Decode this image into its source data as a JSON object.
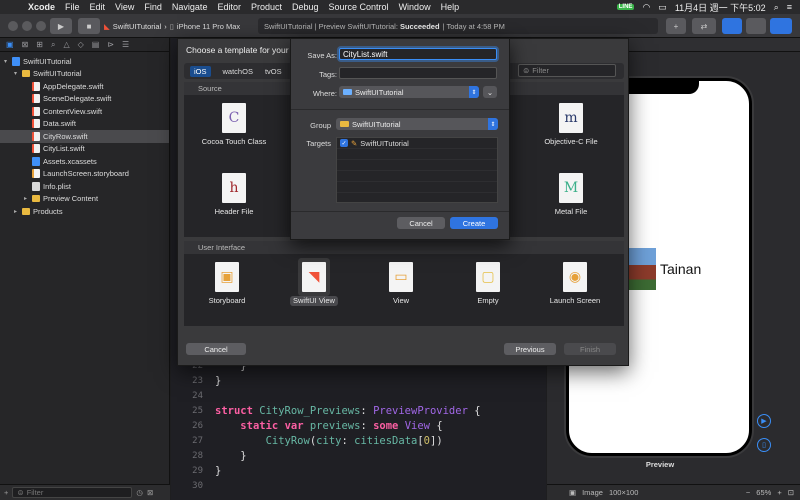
{
  "menubar": {
    "app": "Xcode",
    "items": [
      "File",
      "Edit",
      "View",
      "Find",
      "Navigate",
      "Editor",
      "Product",
      "Debug",
      "Source Control",
      "Window",
      "Help"
    ],
    "line_badge": "LINE",
    "clock": "11月4日 週一 下午5:02"
  },
  "toolbar": {
    "scheme": "SwiftUITutorial",
    "device": "iPhone 11 Pro Max",
    "activity_prefix": "SwiftUITutorial | Preview SwiftUITutorial:",
    "activity_status": "Succeeded",
    "activity_time": "| Today at 4:58 PM"
  },
  "navigator": {
    "items": [
      {
        "label": "SwiftUITutorial",
        "icon": "project",
        "indent": 0,
        "disclose": "▾"
      },
      {
        "label": "SwiftUITutorial",
        "icon": "folder",
        "indent": 1,
        "disclose": "▾"
      },
      {
        "label": "AppDelegate.swift",
        "icon": "swift",
        "indent": 2,
        "disclose": ""
      },
      {
        "label": "SceneDelegate.swift",
        "icon": "swift",
        "indent": 2,
        "disclose": ""
      },
      {
        "label": "ContentView.swift",
        "icon": "swift",
        "indent": 2,
        "disclose": ""
      },
      {
        "label": "Data.swift",
        "icon": "swift",
        "indent": 2,
        "disclose": ""
      },
      {
        "label": "CityRow.swift",
        "icon": "swift",
        "indent": 2,
        "disclose": "",
        "selected": true
      },
      {
        "label": "CityList.swift",
        "icon": "swift",
        "indent": 2,
        "disclose": ""
      },
      {
        "label": "Assets.xcassets",
        "icon": "blue",
        "indent": 2,
        "disclose": ""
      },
      {
        "label": "LaunchScreen.storyboard",
        "icon": "story",
        "indent": 2,
        "disclose": ""
      },
      {
        "label": "Info.plist",
        "icon": "plist",
        "indent": 2,
        "disclose": ""
      },
      {
        "label": "Preview Content",
        "icon": "folder",
        "indent": 2,
        "disclose": "▸"
      },
      {
        "label": "Products",
        "icon": "folder",
        "indent": 1,
        "disclose": "▸"
      }
    ],
    "filter_placeholder": "Filter"
  },
  "editor": {
    "lines": [
      {
        "n": "22",
        "code": "    }"
      },
      {
        "n": "23",
        "code": "}"
      },
      {
        "n": "24",
        "code": ""
      },
      {
        "n": "25",
        "code": "struct CityRow_Previews: PreviewProvider {"
      },
      {
        "n": "26",
        "code": "    static var previews: some View {"
      },
      {
        "n": "27",
        "code": "        CityRow(city: citiesData[0])"
      },
      {
        "n": "28",
        "code": "    }"
      },
      {
        "n": "29",
        "code": "}"
      },
      {
        "n": "30",
        "code": ""
      }
    ]
  },
  "template_chooser": {
    "title": "Choose a template for your",
    "platforms": [
      "iOS",
      "watchOS",
      "tvOS"
    ],
    "filter_placeholder": "Filter",
    "source_header": "Source",
    "source_tiles": [
      {
        "label": "Cocoa Touch Class",
        "glyph": "C",
        "color": "#7b5fb0"
      },
      {
        "label": "Objective-C File",
        "glyph": "m",
        "color": "#2b3a6b"
      },
      {
        "label": "Header File",
        "glyph": "h",
        "color": "#a0282c"
      },
      {
        "label": "Metal File",
        "glyph": "M",
        "color": "#3cb08a"
      }
    ],
    "ui_header": "User Interface",
    "ui_tiles": [
      {
        "label": "Storyboard",
        "glyph": "▣",
        "color": "#e6a13a"
      },
      {
        "label": "SwiftUI View",
        "glyph": "◥",
        "color": "#f05138",
        "selected": true
      },
      {
        "label": "View",
        "glyph": "▭",
        "color": "#e6a13a"
      },
      {
        "label": "Empty",
        "glyph": "▢",
        "color": "#e6c14a"
      },
      {
        "label": "Launch Screen",
        "glyph": "◉",
        "color": "#e6a13a"
      }
    ],
    "cancel": "Cancel",
    "previous": "Previous",
    "finish": "Finish"
  },
  "save_panel": {
    "save_as_label": "Save As:",
    "save_as_value": "CityList.swift",
    "tags_label": "Tags:",
    "where_label": "Where:",
    "where_value": "SwiftUITutorial",
    "group_label": "Group",
    "group_value": "SwiftUITutorial",
    "targets_label": "Targets",
    "target": "SwiftUITutorial",
    "cancel": "Cancel",
    "create": "Create"
  },
  "canvas": {
    "city_name": "Tainan",
    "preview_label": "Preview",
    "status_image": "Image",
    "status_size": "100×100",
    "zoom": "65%"
  }
}
